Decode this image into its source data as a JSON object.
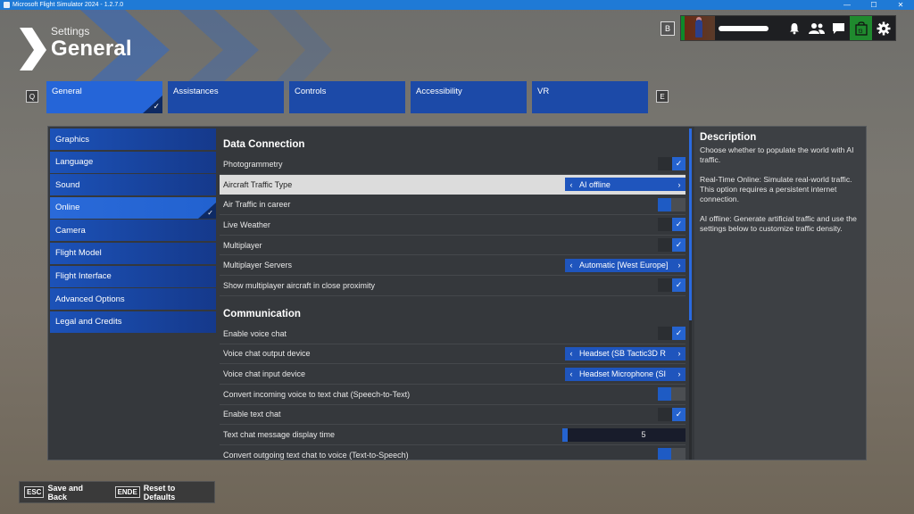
{
  "window": {
    "title": "Microsoft Flight Simulator 2024 - 1.2.7.0",
    "minimize": "—",
    "maximize": "☐",
    "close": "✕"
  },
  "header": {
    "pretitle": "Settings",
    "title": "General"
  },
  "userbar": {
    "b_key": "B",
    "icons": [
      "bell-icon",
      "friends-icon",
      "chat-icon",
      "store-icon",
      "gear-icon"
    ],
    "store_label": "f3"
  },
  "tabs": {
    "prev_key": "Q",
    "next_key": "E",
    "items": [
      {
        "label": "General"
      },
      {
        "label": "Assistances"
      },
      {
        "label": "Controls"
      },
      {
        "label": "Accessibility"
      },
      {
        "label": "VR"
      }
    ],
    "check": "✓"
  },
  "sidebar": {
    "items": [
      {
        "label": "Graphics"
      },
      {
        "label": "Language"
      },
      {
        "label": "Sound"
      },
      {
        "label": "Online"
      },
      {
        "label": "Camera"
      },
      {
        "label": "Flight Model"
      },
      {
        "label": "Flight Interface"
      },
      {
        "label": "Advanced Options"
      },
      {
        "label": "Legal and Credits"
      }
    ]
  },
  "settings": {
    "data_connection": {
      "title": "Data Connection",
      "rows": [
        {
          "label": "Photogrammetry",
          "value": true
        },
        {
          "label": "Aircraft Traffic Type",
          "value": "AI offline"
        },
        {
          "label": "Air Traffic in career",
          "value": false
        },
        {
          "label": "Live Weather",
          "value": true
        },
        {
          "label": "Multiplayer",
          "value": true
        },
        {
          "label": "Multiplayer Servers",
          "value": "Automatic [West Europe]"
        },
        {
          "label": "Show multiplayer aircraft in close proximity",
          "value": true
        }
      ]
    },
    "communication": {
      "title": "Communication",
      "rows": [
        {
          "label": "Enable voice chat",
          "value": true
        },
        {
          "label": "Voice chat output device",
          "value": "Headset (SB Tactic3D R"
        },
        {
          "label": "Voice chat input device",
          "value": "Headset Microphone (SI"
        },
        {
          "label": "Convert incoming voice to text chat (Speech-to-Text)",
          "value": false
        },
        {
          "label": "Enable text chat",
          "value": true
        },
        {
          "label": "Text chat message display time",
          "value": "5",
          "fraction": 0.03
        },
        {
          "label": "Convert outgoing text chat to voice (Text-to-Speech)",
          "value": false
        }
      ]
    },
    "check": "✓",
    "arrow_left": "‹",
    "arrow_right": "›"
  },
  "description": {
    "title": "Description",
    "paragraphs": [
      "Choose whether to populate the world with AI traffic.",
      "Real-Time Online: Simulate real-world traffic. This option requires a persistent internet connection.",
      "AI offline: Generate artificial traffic and use the settings below to customize traffic density."
    ]
  },
  "footer": {
    "save_key": "ESC",
    "save_label": "Save and Back",
    "reset_key": "ENDE",
    "reset_label": "Reset to Defaults"
  },
  "colors": {
    "accent": "#2565d8",
    "tab": "#1c4aa8",
    "titlebar": "#1f7ad6"
  }
}
